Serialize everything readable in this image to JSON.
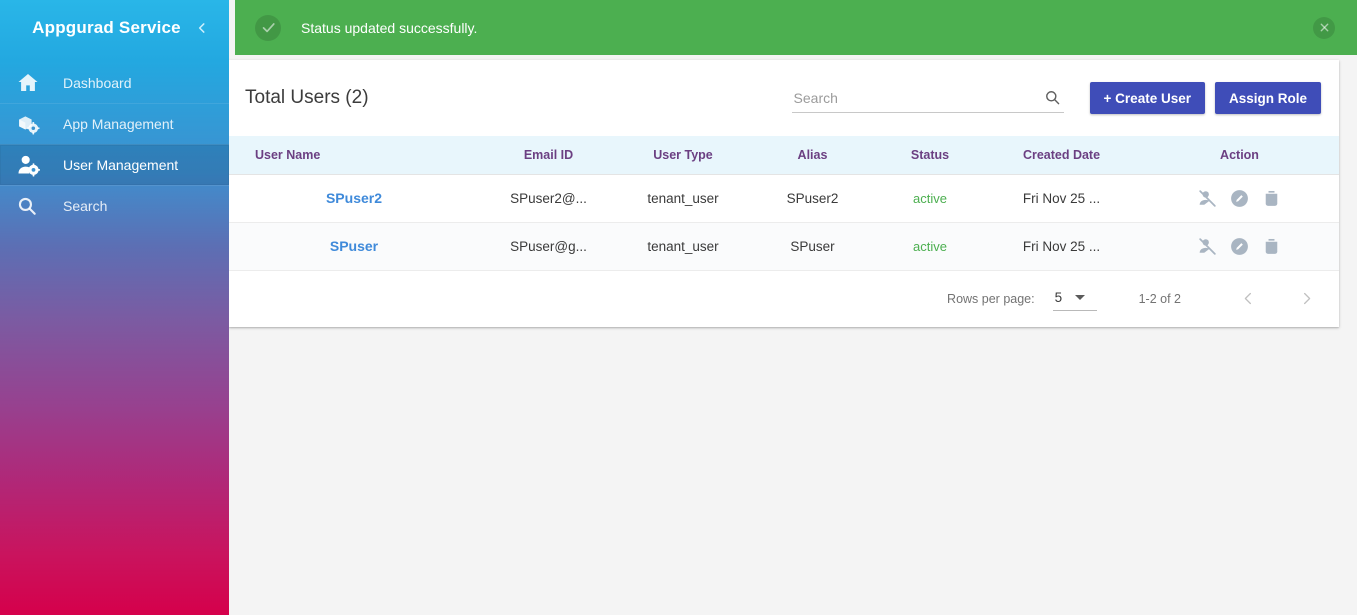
{
  "sidebar": {
    "brand": "Appgurad Service",
    "collapse_icon": "chevron-left-icon",
    "items": [
      {
        "label": "Dashboard",
        "icon": "home-icon",
        "active": false
      },
      {
        "label": "App Management",
        "icon": "app-settings-icon",
        "active": false
      },
      {
        "label": "User Management",
        "icon": "user-settings-icon",
        "active": true
      },
      {
        "label": "Search",
        "icon": "magnifier-icon",
        "active": false
      }
    ]
  },
  "alert": {
    "message": "Status updated successfully.",
    "icon": "check-circle-icon",
    "close_icon": "close-icon",
    "background": "#4caf50"
  },
  "card": {
    "title": "Total Users (2)",
    "search": {
      "placeholder": "Search",
      "value": "",
      "icon": "search-icon"
    },
    "buttons": {
      "create_user": "+ Create User",
      "assign_role": "Assign Role",
      "color": "#3f4db8"
    },
    "table": {
      "headers": [
        "User Name",
        "Email ID",
        "User Type",
        "Alias",
        "Status",
        "Created Date",
        "Action"
      ],
      "rows": [
        {
          "user_name": "SPuser2",
          "email": "SPuser2@...",
          "user_type": "tenant_user",
          "alias": "SPuser2",
          "status": "active",
          "created_date": "Fri Nov 25 ...",
          "actions": [
            "disable-user-icon",
            "edit-icon",
            "delete-icon"
          ]
        },
        {
          "user_name": "SPuser",
          "email": "SPuser@g...",
          "user_type": "tenant_user",
          "alias": "SPuser",
          "status": "active",
          "created_date": "Fri Nov 25 ...",
          "actions": [
            "disable-user-icon",
            "edit-icon",
            "delete-icon"
          ]
        }
      ]
    },
    "paginator": {
      "rows_per_page_label": "Rows per page:",
      "rows_per_page_value": "5",
      "range_label": "1-2 of 2",
      "prev_icon": "chevron-left-icon",
      "next_icon": "chevron-right-icon"
    }
  },
  "colors": {
    "status_active": "#4caf50",
    "username_link": "#3f8ada",
    "table_header_text": "#6b3f82",
    "table_header_bg": "#e8f6fc",
    "page_background": "#f4f4f4"
  }
}
